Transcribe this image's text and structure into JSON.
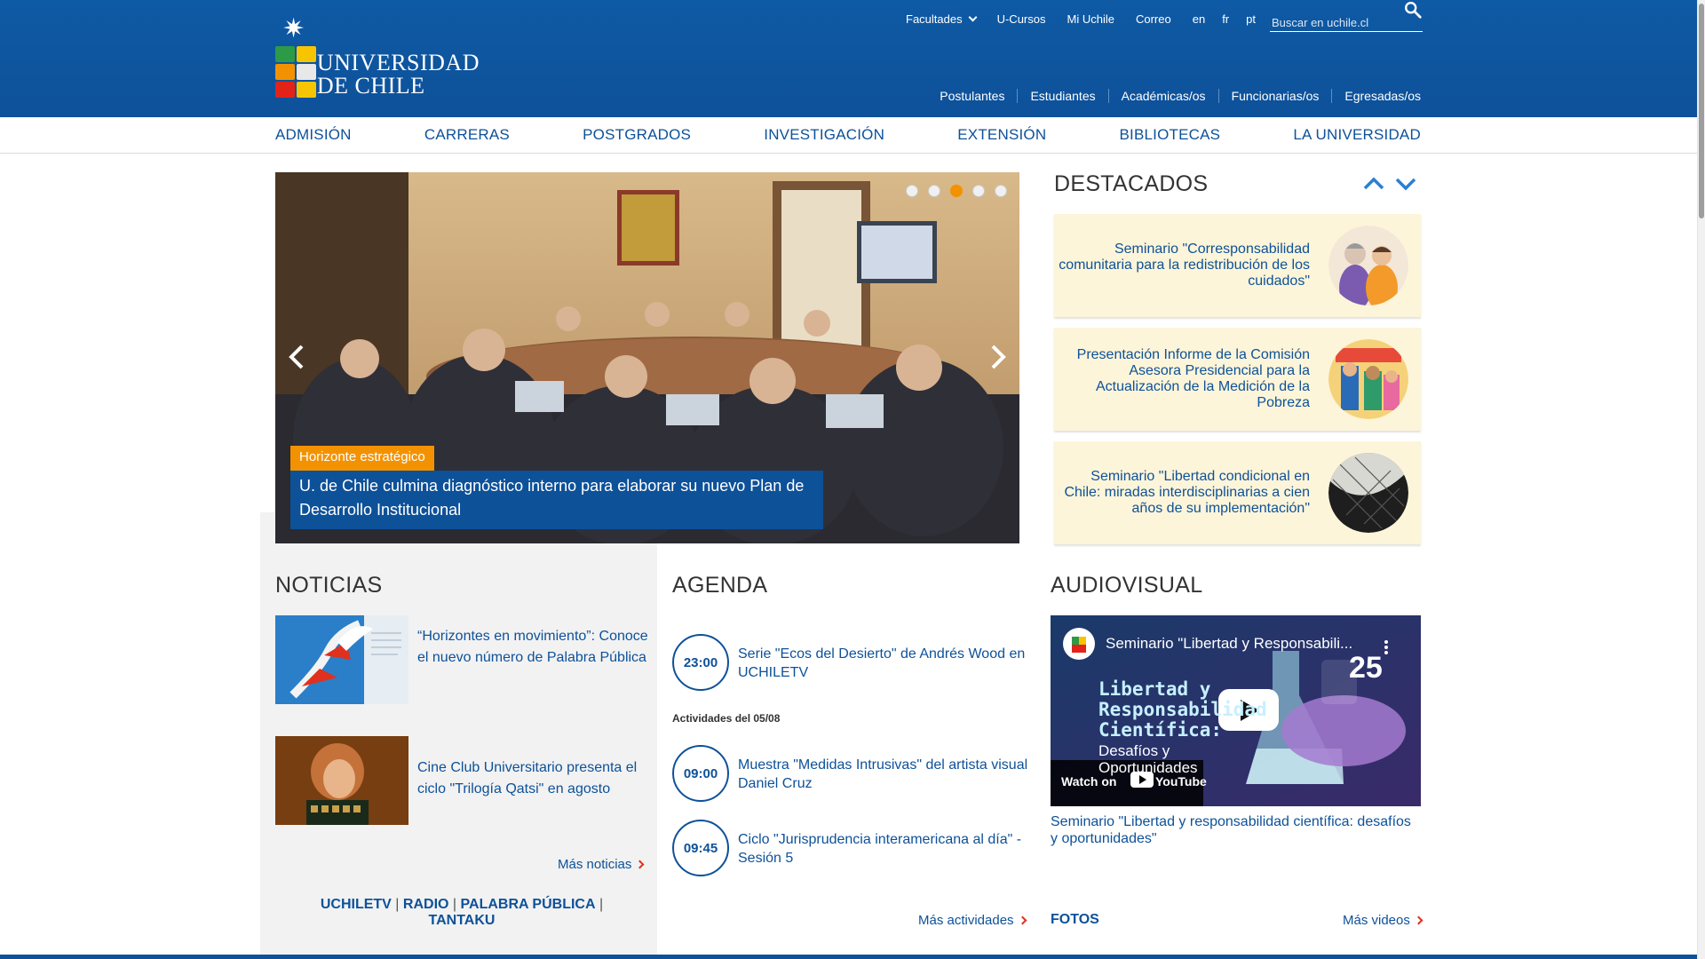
{
  "header": {
    "logo_line1": "UNIVERSIDAD",
    "logo_line2": "DE CHILE",
    "top_links": [
      "Facultades",
      "U-Cursos",
      "Mi Uchile",
      "Correo",
      "en",
      "fr",
      "pt"
    ],
    "search_placeholder": "Buscar en uchile.cl",
    "profile_links": [
      "Postulantes",
      "Estudiantes",
      "Académicas/os",
      "Funcionarias/os",
      "Egresadas/os"
    ]
  },
  "nav": [
    "ADMISIÓN",
    "CARRERAS",
    "POSTGRADOS",
    "INVESTIGACIÓN",
    "EXTENSIÓN",
    "BIBLIOTECAS",
    "LA UNIVERSIDAD"
  ],
  "slider": {
    "dots": 5,
    "active_dot": 3,
    "tag": "Horizonte estratégico",
    "caption": "U. de Chile culmina diagnóstico interno para elaborar su nuevo Plan de Desarrollo Institucional"
  },
  "destacados": {
    "title": "DESTACADOS",
    "items": [
      {
        "text": "Seminario \"Corresponsabilidad comunitaria para la redistribución de los cuidados\""
      },
      {
        "text": "Presentación Informe de la Comisión Asesora Presidencial para la Actualización de la Medición de la Pobreza"
      },
      {
        "text": "Seminario \"Libertad condicional en Chile: miradas interdisciplinarias a cien años de su implementación\""
      }
    ]
  },
  "noticias": {
    "title": "NOTICIAS",
    "items": [
      {
        "text": "“Horizontes en movimiento”: Conoce el nuevo número de Palabra Pública"
      },
      {
        "text": "Cine Club Universitario presenta el ciclo \"Trilogía Qatsi\" en agosto"
      }
    ],
    "more": "Más noticias",
    "media": [
      "UCHILETV",
      "RADIO",
      "PALABRA PÚBLICA",
      "TANTAKU"
    ],
    "media_sep": "|"
  },
  "agenda": {
    "title": "AGENDA",
    "items": [
      {
        "time": "23:00",
        "text": "Serie \"Ecos del Desierto\" de Andrés Wood en UCHILETV"
      },
      {
        "time": "09:00",
        "text": "Muestra \"Medidas Intrusivas\" del artista visual Daniel Cruz"
      },
      {
        "time": "09:45",
        "text": "Ciclo \"Jurisprudencia interamericana al día\" - Sesión 5"
      }
    ],
    "date_label": "Actividades del 05/08",
    "more": "Más actividades"
  },
  "audiovisual": {
    "title": "AUDIOVISUAL",
    "video_header": "Seminario \"Libertad y Responsabili...",
    "video_big_line1": "Libertad y",
    "video_big_line2": "Responsabilidad",
    "video_big_line3": "Científica:",
    "video_sub1": "Desafíos y",
    "video_sub2": "Oportunidades",
    "video_badge": "25",
    "watch_on": "Watch on",
    "youtube": "YouTube",
    "video_title": "Seminario \"Libertad y responsabilidad científica: desafíos y oportunidades\"",
    "fotos": "FOTOS",
    "more": "Más videos"
  },
  "colors": {
    "brand_blue": "#0d5199",
    "accent_orange": "#f39200",
    "card_yellow": "#fdf5d9"
  }
}
